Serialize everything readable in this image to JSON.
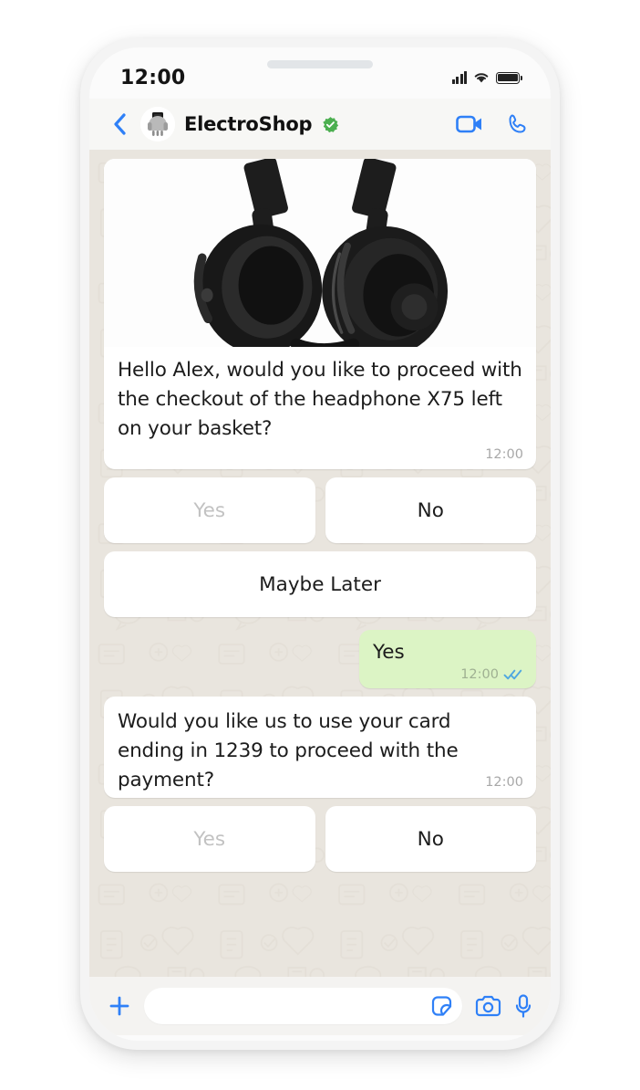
{
  "status_bar": {
    "time": "12:00",
    "signal_icon": "signal-bars-icon",
    "wifi_icon": "wifi-icon",
    "battery_icon": "battery-icon"
  },
  "header": {
    "back_icon": "back-chevron-icon",
    "avatar_icon": "contact-avatar",
    "contact_name": "ElectroShop",
    "verified_icon": "verified-badge-icon",
    "video_call_icon": "video-call-icon",
    "voice_call_icon": "phone-call-icon"
  },
  "chat": {
    "messages": [
      {
        "id": "msg-1",
        "direction": "incoming",
        "has_media": true,
        "media_alt": "headphone-product-image",
        "text": "Hello Alex, would you like to proceed with the checkout of the headphone X75 left on your basket?",
        "time": "12:00"
      },
      {
        "id": "msg-2",
        "direction": "outgoing",
        "text": "Yes",
        "time": "12:00",
        "status_icon": "double-check-read-icon"
      },
      {
        "id": "msg-3",
        "direction": "incoming",
        "has_media": false,
        "text": "Would you like us to use your card ending in 1239 to proceed with the payment?",
        "time": "12:00"
      }
    ],
    "quick_replies_1": [
      {
        "label": "Yes",
        "state": "used"
      },
      {
        "label": "No",
        "state": "active"
      }
    ],
    "quick_replies_1_full": {
      "label": "Maybe Later",
      "state": "active"
    },
    "quick_replies_2": [
      {
        "label": "Yes",
        "state": "used"
      },
      {
        "label": "No",
        "state": "active"
      }
    ]
  },
  "input_bar": {
    "plus_icon": "plus-icon",
    "message_value": "",
    "message_placeholder": "",
    "sticker_icon": "sticker-icon",
    "camera_icon": "camera-icon",
    "mic_icon": "microphone-icon"
  },
  "colors": {
    "accent_blue": "#3b87f7",
    "outgoing_bubble": "#dcf4c5",
    "incoming_bubble": "#ffffff",
    "chat_background": "#e9e5de",
    "verified_green": "#4caf50",
    "muted_text": "#c2c2c2"
  }
}
